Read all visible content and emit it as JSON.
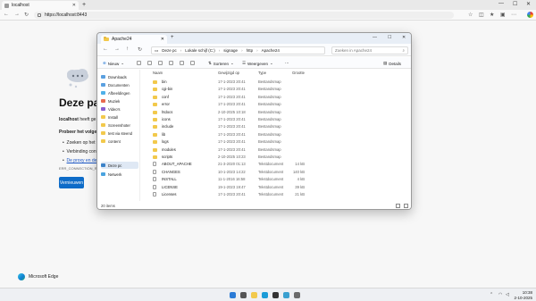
{
  "browser": {
    "tab_title": "localhost",
    "tab_close": "✕",
    "new_tab": "+",
    "url": "https://localhost:8443",
    "win_min": "—",
    "win_max": "☐",
    "win_close": "✕"
  },
  "error_page": {
    "title": "Deze pag",
    "line1_bold": "localhost",
    "line1_rest": " heeft ge",
    "try_heading": "Probeer het volgen",
    "bullets": [
      "Zoeken op het w",
      "Verbinding contr",
      "De proxy en de fi"
    ],
    "error_code": "ERR_CONNECTION_REFUSED",
    "refresh_label": "Vernieuwen",
    "brand": "Microsoft Edge"
  },
  "explorer": {
    "tab_title": "Apache24",
    "tab_close": "✕",
    "new_tab": "+",
    "win_min": "—",
    "win_max": "☐",
    "win_close": "✕",
    "crumbs": [
      "Deze pc",
      "Lokale schijf (C:)",
      "signage",
      "http",
      "Apache24"
    ],
    "crumb_sep": "›",
    "search_placeholder": "Zoeken in Apache24",
    "commands": {
      "new": "Nieuw",
      "sort": "Sorteren",
      "view": "Weergeven",
      "details": "Details"
    },
    "nav_items": [
      {
        "label": "Downloads",
        "icon": "download-icon"
      },
      {
        "label": "Documenten",
        "icon": "documents-icon"
      },
      {
        "label": "Afbeeldingen",
        "icon": "pictures-icon"
      },
      {
        "label": "Muziek",
        "icon": "music-icon"
      },
      {
        "label": "Video's",
        "icon": "video-icon"
      },
      {
        "label": "Install",
        "icon": "folder-icon"
      },
      {
        "label": "Screenshoter",
        "icon": "folder-icon"
      },
      {
        "label": "test via steend",
        "icon": "folder-icon"
      },
      {
        "label": "content",
        "icon": "folder-icon"
      },
      {
        "label": "Deze pc",
        "icon": "pc-icon"
      },
      {
        "label": "Netwerk",
        "icon": "network-icon"
      }
    ],
    "columns": [
      "Naam",
      "Gewijzigd op",
      "Type",
      "Grootte"
    ],
    "rows": [
      {
        "name": "bin",
        "date": "17-1-2023 20:41",
        "type": "Bestandsmap",
        "size": "",
        "kind": "folder"
      },
      {
        "name": "cgi-bin",
        "date": "17-1-2023 20:41",
        "type": "Bestandsmap",
        "size": "",
        "kind": "folder"
      },
      {
        "name": "conf",
        "date": "17-1-2023 20:41",
        "type": "Bestandsmap",
        "size": "",
        "kind": "folder"
      },
      {
        "name": "error",
        "date": "17-1-2023 20:41",
        "type": "Bestandsmap",
        "size": "",
        "kind": "folder"
      },
      {
        "name": "htdocs",
        "date": "2-10-2025 10:18",
        "type": "Bestandsmap",
        "size": "",
        "kind": "folder"
      },
      {
        "name": "icons",
        "date": "17-1-2023 20:41",
        "type": "Bestandsmap",
        "size": "",
        "kind": "folder"
      },
      {
        "name": "include",
        "date": "17-1-2023 20:41",
        "type": "Bestandsmap",
        "size": "",
        "kind": "folder"
      },
      {
        "name": "lib",
        "date": "17-1-2023 20:41",
        "type": "Bestandsmap",
        "size": "",
        "kind": "folder"
      },
      {
        "name": "logs",
        "date": "17-1-2023 20:41",
        "type": "Bestandsmap",
        "size": "",
        "kind": "folder"
      },
      {
        "name": "modules",
        "date": "17-1-2023 20:41",
        "type": "Bestandsmap",
        "size": "",
        "kind": "folder"
      },
      {
        "name": "scripts",
        "date": "2-10-2025 10:23",
        "type": "Bestandsmap",
        "size": "",
        "kind": "folder"
      },
      {
        "name": "ABOUT_APACHE",
        "date": "21-3-2020 01:13",
        "type": "Tekstdocument",
        "size": "14 kB",
        "kind": "file"
      },
      {
        "name": "CHANGES",
        "date": "10-1-2023 14:22",
        "type": "Tekstdocument",
        "size": "140 kB",
        "kind": "file"
      },
      {
        "name": "INSTALL",
        "date": "11-1-2016 16:58",
        "type": "Tekstdocument",
        "size": "4 kB",
        "kind": "file"
      },
      {
        "name": "LICENSE",
        "date": "19-1-2023 19:47",
        "type": "Tekstdocument",
        "size": "39 kB",
        "kind": "file"
      },
      {
        "name": "Licenses",
        "date": "17-1-2023 20:41",
        "type": "Tekstdocument",
        "size": "21 kB",
        "kind": "file"
      }
    ],
    "status": "20 items"
  },
  "taskbar": {
    "time": "10:38",
    "date": "2-10-2025",
    "apps": [
      {
        "name": "start-icon",
        "color": "#2b7bd6"
      },
      {
        "name": "search-icon",
        "color": "#555555"
      },
      {
        "name": "file-explorer-icon",
        "color": "#f2c94c"
      },
      {
        "name": "edge-icon",
        "color": "#1a9bd7"
      },
      {
        "name": "terminal-icon",
        "color": "#333333"
      },
      {
        "name": "notepad-icon",
        "color": "#3aa0d0"
      },
      {
        "name": "store-icon",
        "color": "#6b6b6b"
      }
    ]
  }
}
